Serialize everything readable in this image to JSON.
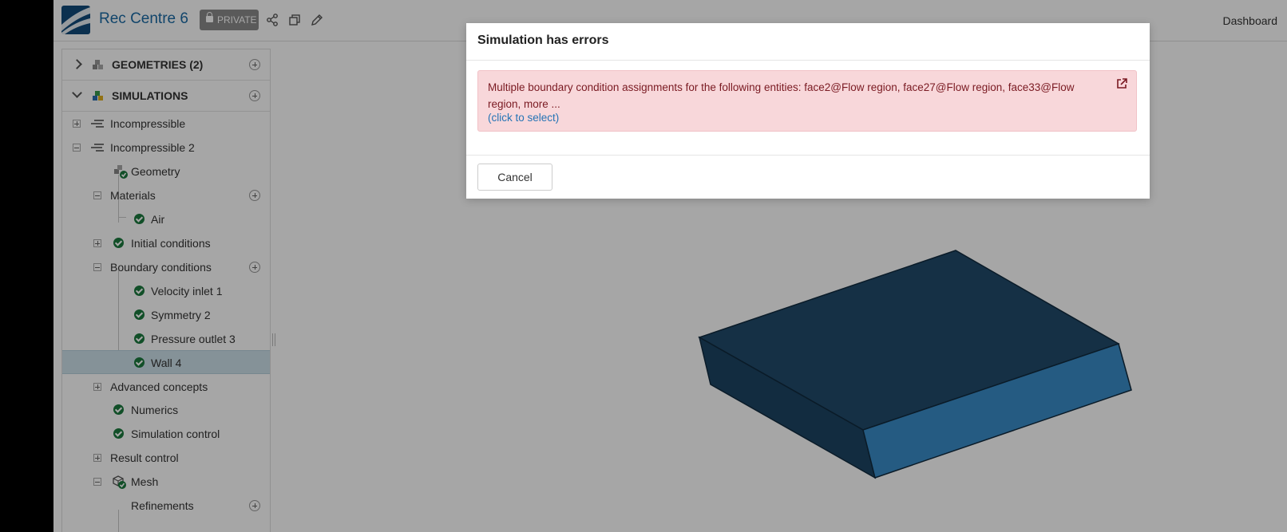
{
  "header": {
    "project_title": "Rec Centre 6",
    "privacy_badge": "PRIVATE",
    "dashboard_link": "Dashboard"
  },
  "sidebar": {
    "geometries_label": "GEOMETRIES (2)",
    "simulations_label": "SIMULATIONS",
    "tree": [
      {
        "label": "Incompressible"
      },
      {
        "label": "Incompressible 2"
      },
      {
        "label": "Geometry"
      },
      {
        "label": "Materials"
      },
      {
        "label": "Air"
      },
      {
        "label": "Initial conditions"
      },
      {
        "label": "Boundary conditions"
      },
      {
        "label": "Velocity inlet 1"
      },
      {
        "label": "Symmetry 2"
      },
      {
        "label": "Pressure outlet 3"
      },
      {
        "label": "Wall 4"
      },
      {
        "label": "Advanced concepts"
      },
      {
        "label": "Numerics"
      },
      {
        "label": "Simulation control"
      },
      {
        "label": "Result control"
      },
      {
        "label": "Mesh"
      },
      {
        "label": "Refinements"
      }
    ]
  },
  "modal": {
    "title": "Simulation has errors",
    "error_message": "Multiple boundary condition assignments for the following entities: face2@Flow region, face27@Flow region, face33@Flow region, more ...",
    "select_link": "(click to select)",
    "cancel_label": "Cancel"
  },
  "colors": {
    "accent": "#1b6aa5",
    "success": "#1b7a3e",
    "error_bg": "#f8d7da",
    "error_text": "#7a1a22",
    "box_top": "#214a6b",
    "box_side": "#3a8cc8"
  }
}
